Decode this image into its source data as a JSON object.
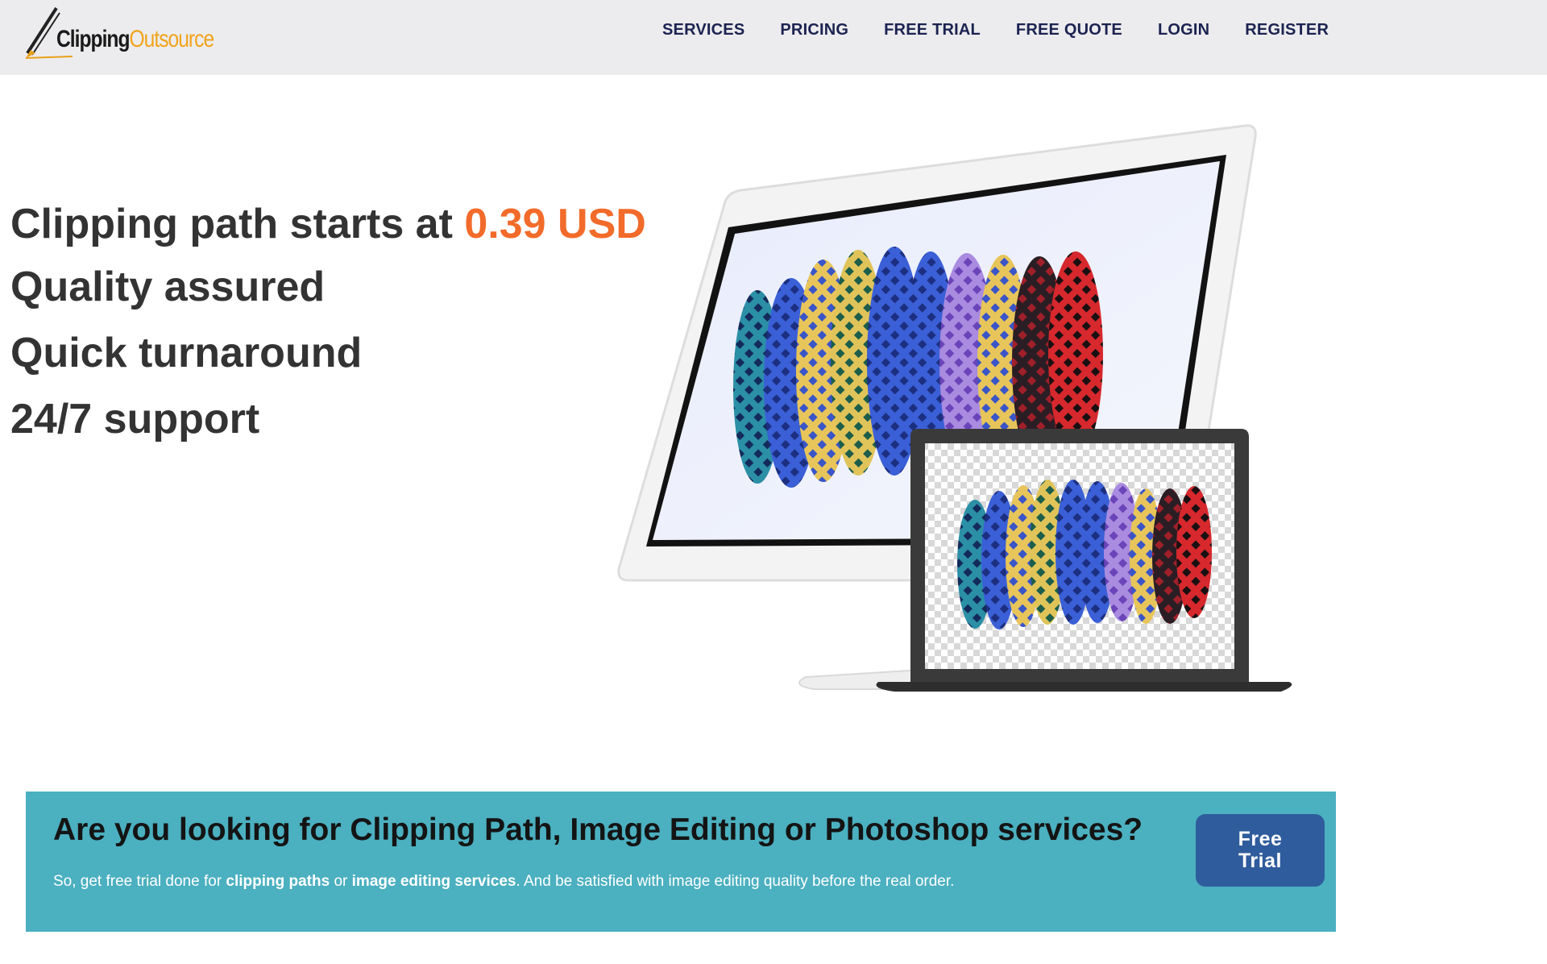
{
  "header": {
    "logo": {
      "part1": "Clipping",
      "part2": "Outsource"
    },
    "nav": [
      "SERVICES",
      "PRICING",
      "FREE TRIAL",
      "FREE QUOTE",
      "LOGIN",
      "REGISTER"
    ]
  },
  "hero": {
    "line1_prefix": "Clipping path starts at ",
    "line1_price": "0.39 USD",
    "line2": "Quality assured",
    "line3": "Quick turnaround",
    "line4": "24/7 support"
  },
  "banner": {
    "title": "Are you looking for Clipping Path, Image Editing or Photoshop services?",
    "sub_1": "So, get free trial done for ",
    "sub_bold_1": "clipping paths",
    "sub_2": " or ",
    "sub_bold_2": "image editing services",
    "sub_3": ". And be satisfied with image editing quality before the real order.",
    "button_line1": "Free",
    "button_line2": "Trial"
  },
  "colors": {
    "price_accent": "#f26b2a",
    "nav_text": "#1c2351",
    "banner_bg": "#4bb0c0",
    "button_bg": "#2f5c9c",
    "logo_accent": "#f2a31b"
  }
}
